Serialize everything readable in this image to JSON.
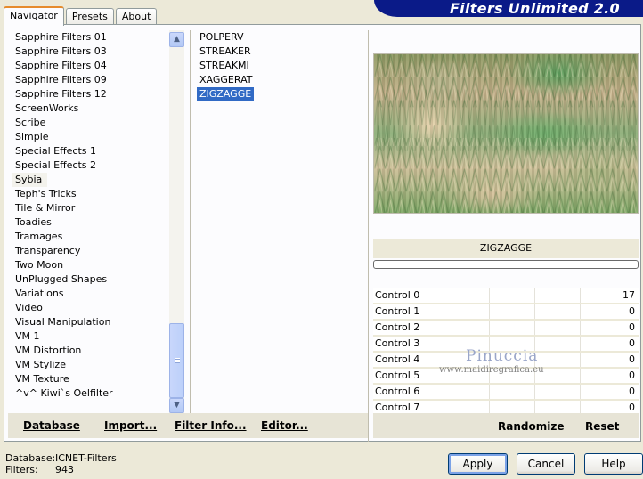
{
  "app": {
    "title": "Filters Unlimited 2.0"
  },
  "tabs": [
    {
      "label": "Navigator",
      "active": true
    },
    {
      "label": "Presets",
      "active": false
    },
    {
      "label": "About",
      "active": false
    }
  ],
  "categories": {
    "items": [
      "Sapphire Filters 01",
      "Sapphire Filters 03",
      "Sapphire Filters 04",
      "Sapphire Filters 09",
      "Sapphire Filters 12",
      "ScreenWorks",
      "Scribe",
      "Simple",
      "Special Effects 1",
      "Special Effects 2",
      "Sybia",
      "Teph's Tricks",
      "Tile & Mirror",
      "Toadies",
      "Tramages",
      "Transparency",
      "Two Moon",
      "UnPlugged Shapes",
      "Variations",
      "Video",
      "Visual Manipulation",
      "VM 1",
      "VM Distortion",
      "VM Stylize",
      "VM Texture",
      "^v^ Kiwi`s Oelfilter"
    ],
    "selected": "Sybia"
  },
  "filters": {
    "items": [
      "POLPERV",
      "STREAKER",
      "STREAKMI",
      "XAGGERAT",
      "ZIGZAGGE"
    ],
    "selected": "ZIGZAGGE"
  },
  "left_buttons": {
    "database": "Database",
    "import": "Import...",
    "filter_info": "Filter Info...",
    "editor": "Editor..."
  },
  "preview": {
    "filter_name": "ZIGZAGGE",
    "progress": 0
  },
  "controls": [
    {
      "label": "Control 0",
      "value": "17"
    },
    {
      "label": "Control 1",
      "value": "0"
    },
    {
      "label": "Control 2",
      "value": "0"
    },
    {
      "label": "Control 3",
      "value": "0"
    },
    {
      "label": "Control 4",
      "value": "0"
    },
    {
      "label": "Control 5",
      "value": "0"
    },
    {
      "label": "Control 6",
      "value": "0"
    },
    {
      "label": "Control 7",
      "value": "0"
    }
  ],
  "right_buttons": {
    "randomize": "Randomize",
    "reset": "Reset"
  },
  "watermark": {
    "title": "Pinuccia",
    "url": "www.maidiregrafica.eu"
  },
  "status": {
    "database_label": "Database:",
    "database_value": "ICNET-Filters",
    "filters_label": "Filters:",
    "filters_value": "943"
  },
  "dialog_buttons": {
    "apply": "Apply",
    "cancel": "Cancel",
    "help": "Help"
  },
  "colors": {
    "banner": "#0a1a88",
    "selection": "#316ac5",
    "tab_accent": "#e68b2c"
  },
  "icons": {
    "scroll_up": "chevron-up-icon",
    "scroll_down": "chevron-down-icon"
  }
}
